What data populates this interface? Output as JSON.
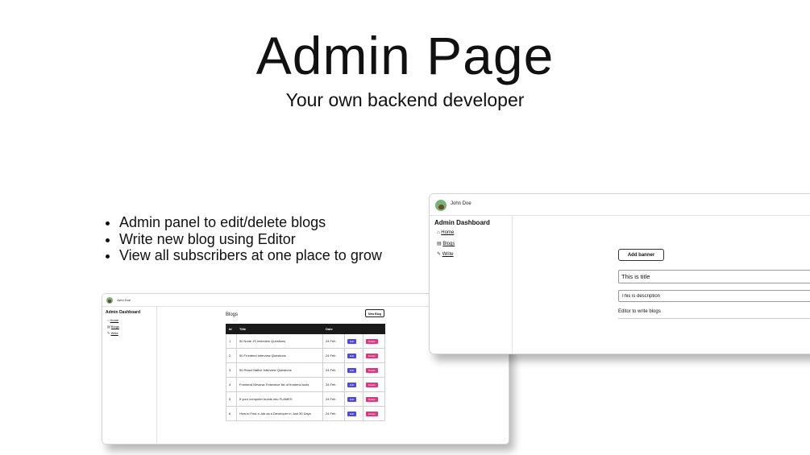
{
  "hero": {
    "title": "Admin Page",
    "subtitle": "Your own backend developer"
  },
  "features": [
    "Admin panel to edit/delete blogs",
    "Write new blog using Editor",
    "View all subscribers at one place to grow"
  ],
  "blogs_window": {
    "user_name": "John Doe",
    "sidebar": {
      "title": "Admin Dashboard",
      "items": [
        {
          "icon": "home-icon",
          "label": "Home"
        },
        {
          "icon": "blogs-icon",
          "label": "Blogs"
        },
        {
          "icon": "pencil-icon",
          "label": "Write"
        }
      ]
    },
    "heading": "Blogs",
    "new_blog_label": "New Blog",
    "table": {
      "headers": [
        "Id",
        "Title",
        "Date",
        "",
        ""
      ],
      "rows": [
        {
          "id": "1",
          "title": "50 Node JS Interview Questions",
          "date": "24 Feb",
          "edit": "Edit",
          "delete": "Delete"
        },
        {
          "id": "2",
          "title": "50 Frontend Interview Questions",
          "date": "24 Feb",
          "edit": "Edit",
          "delete": "Delete"
        },
        {
          "id": "3",
          "title": "50 React Native Interview Questions",
          "date": "24 Feb",
          "edit": "Edit",
          "delete": "Delete"
        },
        {
          "id": "4",
          "title": "Frontend Nirvana: Extensive list of frontend tools",
          "date": "24 Feb",
          "edit": "Edit",
          "delete": "Delete"
        },
        {
          "id": "5",
          "title": "If your computer bursts into FLAMES",
          "date": "24 Feb",
          "edit": "Edit",
          "delete": "Delete"
        },
        {
          "id": "6",
          "title": "How to Find a Job as a Developer in Just 30 Days",
          "date": "24 Feb",
          "edit": "Edit",
          "delete": "Delete"
        }
      ]
    }
  },
  "editor_window": {
    "user_name": "John Doe",
    "sidebar": {
      "title": "Admin Dashboard",
      "items": [
        {
          "icon": "home-icon",
          "label": "Home"
        },
        {
          "icon": "blogs-icon",
          "label": "Blogs"
        },
        {
          "icon": "pencil-icon",
          "label": "Write"
        }
      ]
    },
    "add_banner_label": "Add banner",
    "title_value": "This is title",
    "description_value": "This is description",
    "editor_text": "Editor to write blogs"
  },
  "colors": {
    "edit_button": "#4f46e5",
    "delete_button": "#e0357f",
    "table_header": "#1a1a1a",
    "avatar": "#79b279"
  }
}
